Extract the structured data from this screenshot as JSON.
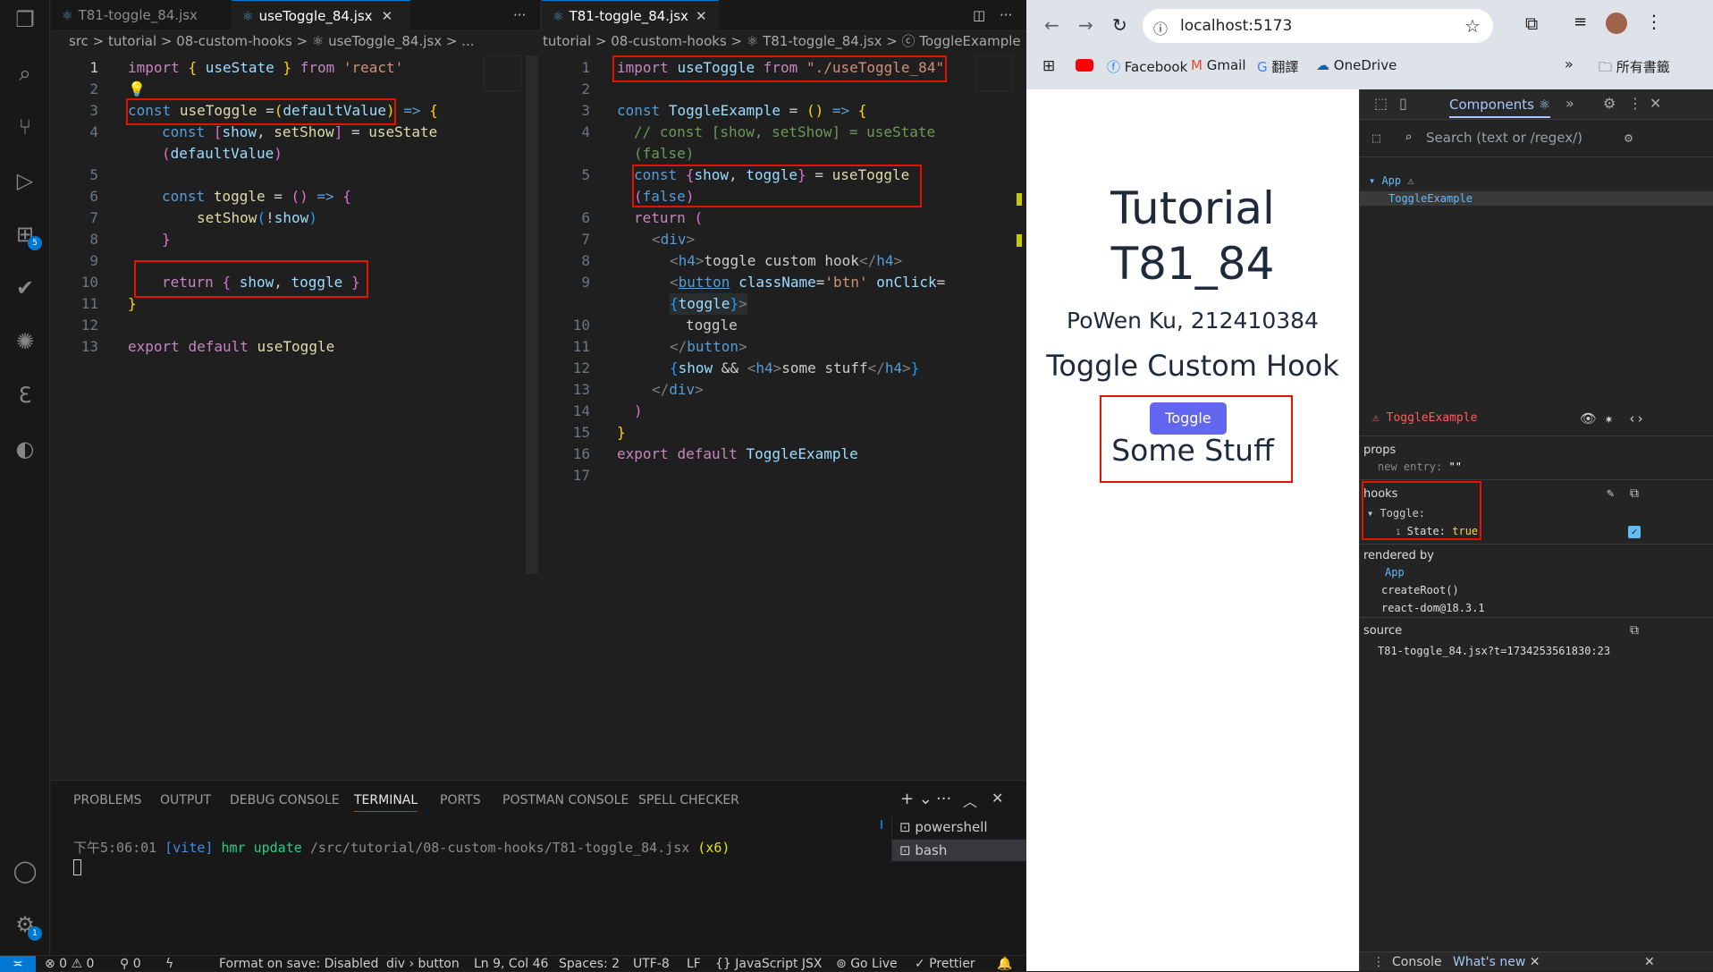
{
  "editor_left": {
    "tab_inactive": "T81-toggle_84.jsx",
    "tab_active": "useToggle_84.jsx",
    "breadcrumb": "src > tutorial > 08-custom-hooks > ⚛ useToggle_84.jsx > ...",
    "line_numbers": [
      "1",
      "2",
      "3",
      "4",
      "",
      "5",
      "6",
      "7",
      "8",
      "9",
      "10",
      "11",
      "12",
      "13"
    ]
  },
  "editor_right": {
    "tab_active": "T81-toggle_84.jsx",
    "breadcrumb": "tutorial > 08-custom-hooks > ⚛ T81-toggle_84.jsx > ⓒ ToggleExample",
    "line_numbers": [
      "1",
      "2",
      "3",
      "4",
      "",
      "5",
      "",
      "6",
      "7",
      "8",
      "9",
      "",
      "10",
      "11",
      "12",
      "13",
      "14",
      "15",
      "16",
      "17"
    ]
  },
  "panel": {
    "tabs": [
      "PROBLEMS",
      "OUTPUT",
      "DEBUG CONSOLE",
      "TERMINAL",
      "PORTS",
      "POSTMAN CONSOLE",
      "SPELL CHECKER"
    ],
    "active_tab": "TERMINAL",
    "terminal_time": "下午5:06:01",
    "terminal_vite": "[vite]",
    "terminal_msg": "hmr update",
    "terminal_path": "/src/tutorial/08-custom-hooks/T81-toggle_84.jsx",
    "terminal_count": "(x6)",
    "shells": [
      "powershell",
      "bash"
    ]
  },
  "status": {
    "errors": "⊗ 0 ⚠ 0",
    "ports": "0",
    "format": "Format on save: Disabled",
    "element": "div › button",
    "position": "Ln 9, Col 46",
    "spaces": "Spaces: 2",
    "encoding": "UTF-8",
    "eol": "LF",
    "language": "JavaScript JSX",
    "golive": "Go Live",
    "prettier": "Prettier"
  },
  "browser": {
    "url": "localhost:5173",
    "bookmarks": [
      "Facebook",
      "Gmail",
      "翻譯",
      "OneDrive"
    ],
    "all_bookmarks": "所有書籤",
    "page_title": "Tutorial T81_84",
    "page_title_line1": "Tutorial",
    "page_title_line2": "T81_84",
    "author": "PoWen Ku, 212410384",
    "heading": "Toggle Custom Hook",
    "toggle_button": "Toggle",
    "stuff": "Some Stuff"
  },
  "devtools": {
    "components_tab": "Components",
    "search_placeholder": "Search (text or /regex/)",
    "tree_app": "App",
    "tree_child": "ToggleExample",
    "selected": "ToggleExample",
    "props_label": "props",
    "new_entry": "new entry:",
    "new_entry_val": "\"\"",
    "hooks_label": "hooks",
    "hook_name": "Toggle:",
    "hook_index": "1",
    "hook_state": "State:",
    "hook_value": "true",
    "rendered_by": "rendered by",
    "rendered": [
      "App",
      "createRoot()",
      "react-dom@18.3.1"
    ],
    "source_label": "source",
    "source": "T81-toggle_84.jsx?t=1734253561830:23",
    "console_tab": "Console",
    "whatsnew_tab": "What's new"
  }
}
